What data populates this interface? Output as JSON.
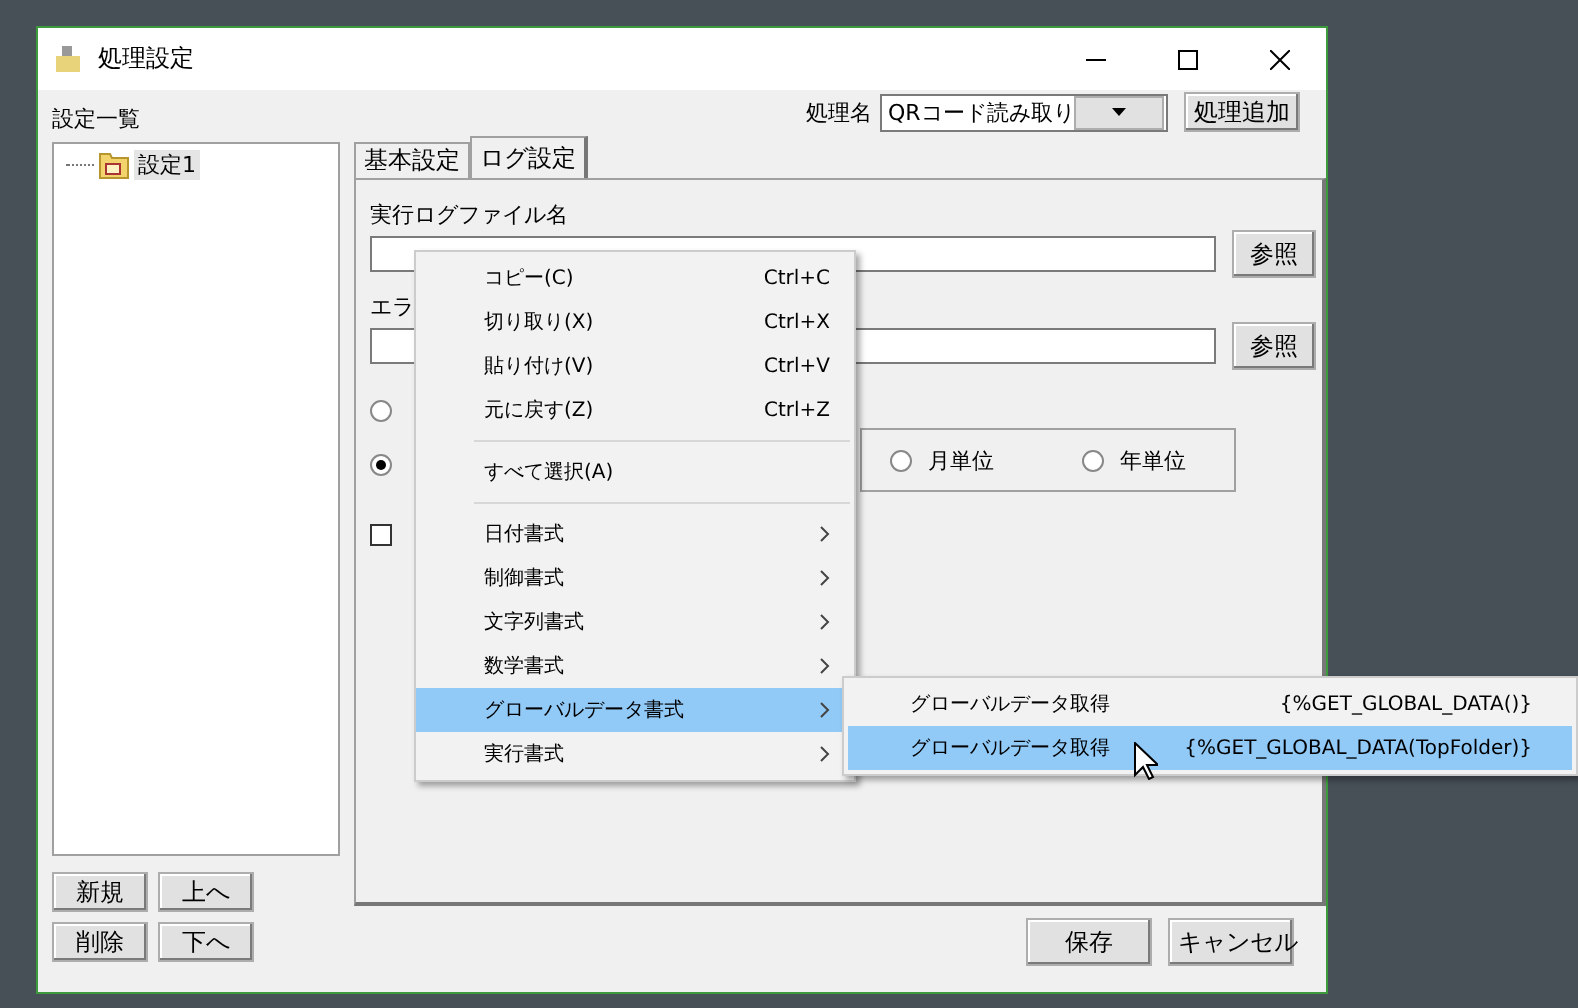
{
  "window": {
    "title": "処理設定"
  },
  "sidebar": {
    "label": "設定一覧",
    "tree": [
      {
        "label": "設定1",
        "selected": true
      }
    ],
    "buttons": [
      "新規",
      "上へ",
      "削除",
      "下へ"
    ]
  },
  "header": {
    "process_label": "処理名",
    "process_combo": "QRコード読み取り",
    "add_button": "処理追加"
  },
  "tabs": [
    {
      "label": "基本設定",
      "selected": false
    },
    {
      "label": "ログ設定",
      "selected": true
    }
  ],
  "log_panel": {
    "fields": [
      {
        "label": "実行ログファイル名",
        "browse": "参照"
      },
      {
        "label": "エラ",
        "browse": "参照"
      }
    ],
    "radios": [
      {
        "selected": false
      },
      {
        "selected": true
      }
    ],
    "unit_radios": [
      {
        "label": "月単位",
        "selected": false
      },
      {
        "label": "年単位",
        "selected": false
      }
    ],
    "checkbox": {
      "checked": false
    }
  },
  "context_menu": [
    {
      "kind": "item",
      "label": "コピー(C)",
      "shortcut": "Ctrl+C",
      "selected": false
    },
    {
      "kind": "item",
      "label": "切り取り(X)",
      "shortcut": "Ctrl+X",
      "selected": false
    },
    {
      "kind": "item",
      "label": "貼り付け(V)",
      "shortcut": "Ctrl+V",
      "selected": false
    },
    {
      "kind": "item",
      "label": "元に戻す(Z)",
      "shortcut": "Ctrl+Z",
      "selected": false
    },
    {
      "kind": "separator"
    },
    {
      "kind": "item",
      "label": "すべて選択(A)",
      "selected": false
    },
    {
      "kind": "separator"
    },
    {
      "kind": "submenu",
      "label": "日付書式",
      "selected": false
    },
    {
      "kind": "submenu",
      "label": "制御書式",
      "selected": false
    },
    {
      "kind": "submenu",
      "label": "文字列書式",
      "selected": false
    },
    {
      "kind": "submenu",
      "label": "数学書式",
      "selected": false
    },
    {
      "kind": "submenu",
      "label": "グローバルデータ書式",
      "selected": true
    },
    {
      "kind": "submenu",
      "label": "実行書式",
      "selected": false
    }
  ],
  "submenu": [
    {
      "label": "グローバルデータ取得",
      "code": "{%GET_GLOBAL_DATA()}",
      "selected": false
    },
    {
      "label": "グローバルデータ取得",
      "code": "{%GET_GLOBAL_DATA(TopFolder)}",
      "selected": true
    }
  ],
  "footer": {
    "buttons": [
      "保存",
      "キャンセル"
    ]
  }
}
